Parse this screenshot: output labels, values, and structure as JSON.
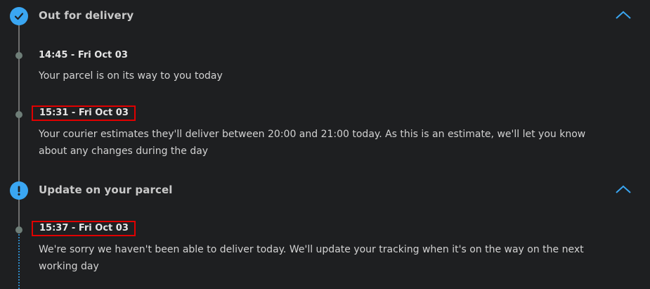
{
  "sections": [
    {
      "title": "Out for delivery",
      "status_icon": "check-icon",
      "events": [
        {
          "time": "14:45 - Fri Oct 03",
          "highlighted": false,
          "description": "Your parcel is on its way to you today"
        },
        {
          "time": "15:31 - Fri Oct 03",
          "highlighted": true,
          "description": "Your courier estimates they'll deliver between 20:00 and 21:00 today. As this is an estimate, we'll let you know about any changes during the day"
        }
      ]
    },
    {
      "title": "Update on your parcel",
      "status_icon": "exclamation-icon",
      "events": [
        {
          "time": "15:37 - Fri Oct 03",
          "highlighted": true,
          "description": "We're sorry we haven't been able to deliver today. We'll update your tracking when it's on the way on the next working day"
        }
      ]
    }
  ],
  "colors": {
    "background": "#1e1f21",
    "accent": "#3aa6f2",
    "highlight_border": "#e00000",
    "timeline_line": "#6e6e6e"
  }
}
